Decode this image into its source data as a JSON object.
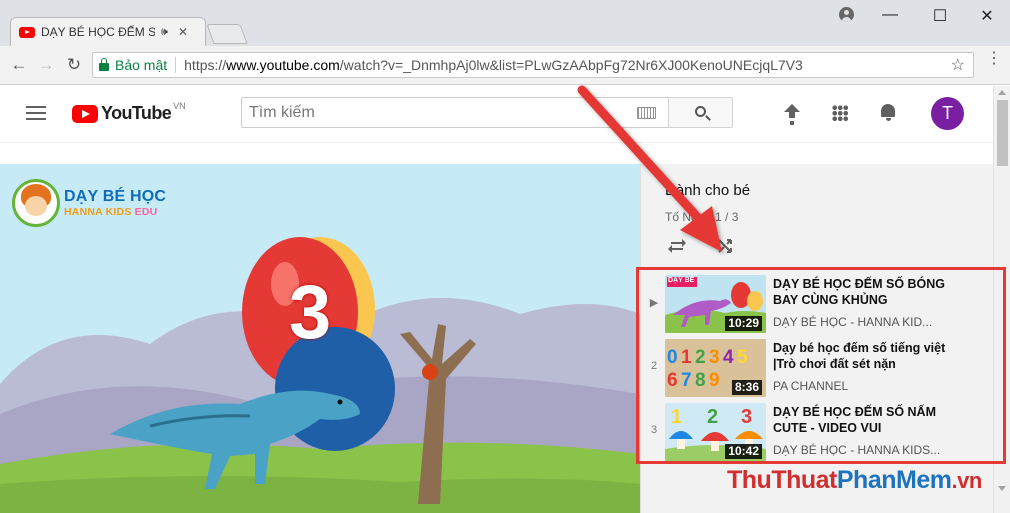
{
  "browser": {
    "tab_title": "DẠY BÉ HỌC ĐẾM SỐ",
    "tab_sound": "🕪",
    "tab_close": "✕",
    "win_min": "—",
    "win_max": "☐",
    "win_close": "✕",
    "back": "←",
    "forward": "→",
    "reload": "↻",
    "secure_label": "Bảo mật",
    "url_protocol": "https://",
    "url_host": "www.youtube.com",
    "url_path": "/watch?v=_DnmhpAj0lw&list=PLwGzAAbpFg72Nr6XJ00KenoUNEcjqL7V3",
    "bookmark_star": "☆",
    "menu": "⋮"
  },
  "youtube": {
    "logo_text": "YouTube",
    "logo_region": "VN",
    "search_placeholder": "Tìm kiếm",
    "avatar_letter": "T"
  },
  "player": {
    "channel_logo_line1": "DẠY BÉ HỌC",
    "channel_logo_line2a": "HANNA KIDS",
    "channel_logo_line2b": "EDU",
    "balloon_number": "3"
  },
  "playlist": {
    "title": "Dành cho bé",
    "subtitle": "Tố Nga - 1 / 3",
    "items": [
      {
        "index": "▶",
        "title": "DẠY BÉ HỌC ĐẾM SỐ BÓNG BAY CÙNG KHỦNG",
        "channel": "DẠY BÉ HỌC - HANNA KID...",
        "duration": "10:29",
        "thumb_badge": "DẠY BÉ"
      },
      {
        "index": "2",
        "title": "Dạy bé học đếm số tiếng việt |Trò chơi đất sét nặn",
        "channel": "PA CHANNEL",
        "duration": "8:36"
      },
      {
        "index": "3",
        "title": "DẠY BÉ HỌC ĐẾM SỐ NẤM CUTE - VIDEO VUI",
        "channel": "DẠY BÉ HỌC - HANNA KIDS...",
        "duration": "10:42"
      }
    ]
  },
  "watermark": {
    "part1": "Thu",
    "part2": "Thuat",
    "part3": "PhanMem",
    "part4": ".vn"
  },
  "colors": {
    "youtube_red": "#ff0000",
    "secure_green": "#0b8043",
    "highlight_red": "#e53935",
    "avatar_purple": "#7a1fa2"
  }
}
